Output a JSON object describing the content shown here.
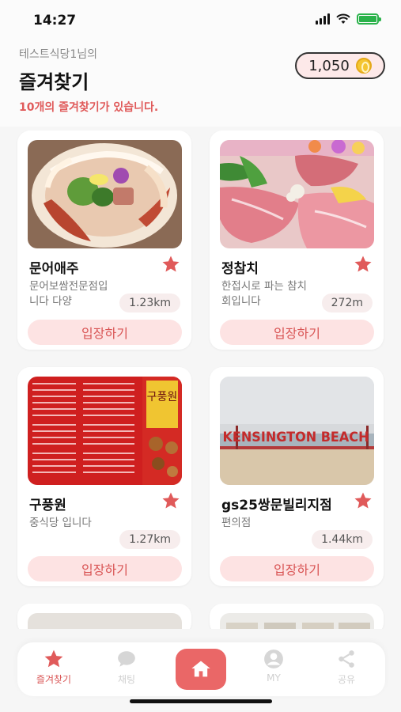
{
  "status_bar": {
    "time": "14:27"
  },
  "header": {
    "greeting": "테스트식당1님의",
    "title": "즐겨찾기",
    "count_text": "10개의 즐겨찾기가 있습니다.",
    "coins": "1,050"
  },
  "cards": [
    {
      "name": "문어애주",
      "description": "문어보쌈전문점입니다 다양",
      "distance": "1.23km",
      "button": "입장하기",
      "favorited": true
    },
    {
      "name": "정참치",
      "description": "한접시로 파는 참치회입니다",
      "distance": "272m",
      "button": "입장하기",
      "favorited": true
    },
    {
      "name": "구풍원",
      "description": "중식당 입니다",
      "distance": "1.27km",
      "button": "입장하기",
      "favorited": true
    },
    {
      "name": "gs25쌍문빌리지점",
      "description": "편의점",
      "distance": "1.44km",
      "button": "입장하기",
      "favorited": true,
      "image_text": "KENSINGTON BEACH"
    }
  ],
  "menu_image_text": "구풍원",
  "nav": {
    "favorites": "즐겨찾기",
    "chat": "채팅",
    "my": "MY",
    "share": "공유"
  },
  "colors": {
    "accent": "#e05a5a",
    "button_bg": "#fde3e3",
    "home": "#ea6767"
  }
}
